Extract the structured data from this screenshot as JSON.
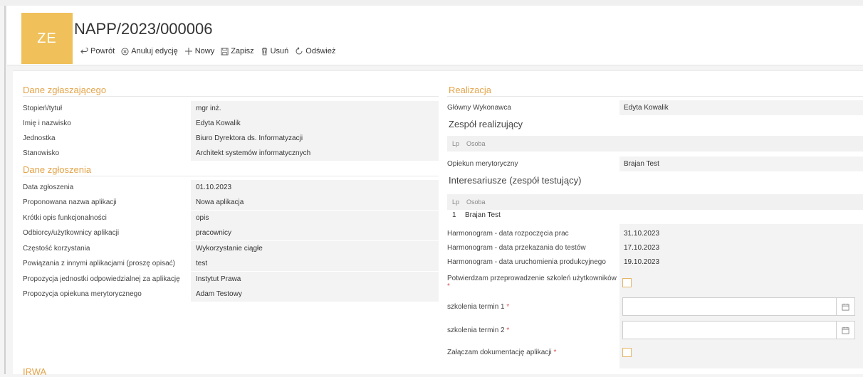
{
  "header": {
    "avatar_initials": "ZE",
    "title": "NAPP/2023/000006",
    "accent_color": "#f0c15a"
  },
  "toolbar": {
    "back_label": "Powrót",
    "cancel_edit_label": "Anuluj edycję",
    "new_label": "Nowy",
    "save_label": "Zapisz",
    "delete_label": "Usuń",
    "refresh_label": "Odśwież"
  },
  "requester": {
    "section_title": "Dane zgłaszającego",
    "fields": [
      {
        "label": "Stopień/tytuł",
        "value": "mgr inż."
      },
      {
        "label": "Imię i nazwisko",
        "value": "Edyta Kowalik"
      },
      {
        "label": "Jednostka",
        "value": "Biuro Dyrektora ds. Informatyzacji"
      },
      {
        "label": "Stanowisko",
        "value": "Architekt systemów informatycznych"
      }
    ]
  },
  "request": {
    "section_title": "Dane zgłoszenia",
    "fields": [
      {
        "label": "Data zgłoszenia",
        "value": "01.10.2023"
      },
      {
        "label": "Proponowana nazwa aplikacji",
        "value": "Nowa aplikacja"
      },
      {
        "label": "Krótki opis funkcjonalności",
        "value": "opis"
      },
      {
        "label": "Odbiorcy/użytkownicy aplikacji",
        "value": "pracownicy"
      },
      {
        "label": "Częstość korzystania",
        "value": "Wykorzystanie ciągłe"
      },
      {
        "label": "Powiązania z innymi aplikacjami (proszę opisać)",
        "value": "test"
      },
      {
        "label": "Propozycja jednostki odpowiedzialnej za aplikację",
        "value": "Instytut Prawa"
      },
      {
        "label": "Propozycja opiekuna merytorycznego",
        "value": "Adam Testowy"
      }
    ]
  },
  "bottom_section_title": "IRWA",
  "realization": {
    "section_title": "Realizacja",
    "main_contractor_label": "Główny Wykonawca",
    "main_contractor_value": "Edyta Kowalik",
    "team_title": "Zespół realizujący",
    "team_columns": [
      "Lp",
      "Osoba"
    ],
    "content_supervisor_label": "Opiekun merytoryczny",
    "content_supervisor_value": "Brajan Test",
    "stakeholders_title": "Interesariusze (zespół testujący)",
    "stakeholders_columns": [
      "Lp",
      "Osoba"
    ],
    "stakeholders_rows": [
      {
        "lp": "1",
        "person": "Brajan Test"
      }
    ],
    "schedule": [
      {
        "label": "Harmonogram - data rozpoczęcia prac",
        "value": "31.10.2023"
      },
      {
        "label": "Harmonogram - data przekazania do testów",
        "value": "17.10.2023"
      },
      {
        "label": "Harmonogram - data uruchomienia produkcyjnego",
        "value": "19.10.2023"
      }
    ],
    "training_confirm_label": "Potwierdzam przeprowadzenie szkoleń użytkowników",
    "training_date1_label": "szkolenia termin 1",
    "training_date2_label": "szkolenia termin 2",
    "documentation_label": "Załączam dokumentację aplikacji",
    "required_mark": "*",
    "date_placeholder": ""
  }
}
